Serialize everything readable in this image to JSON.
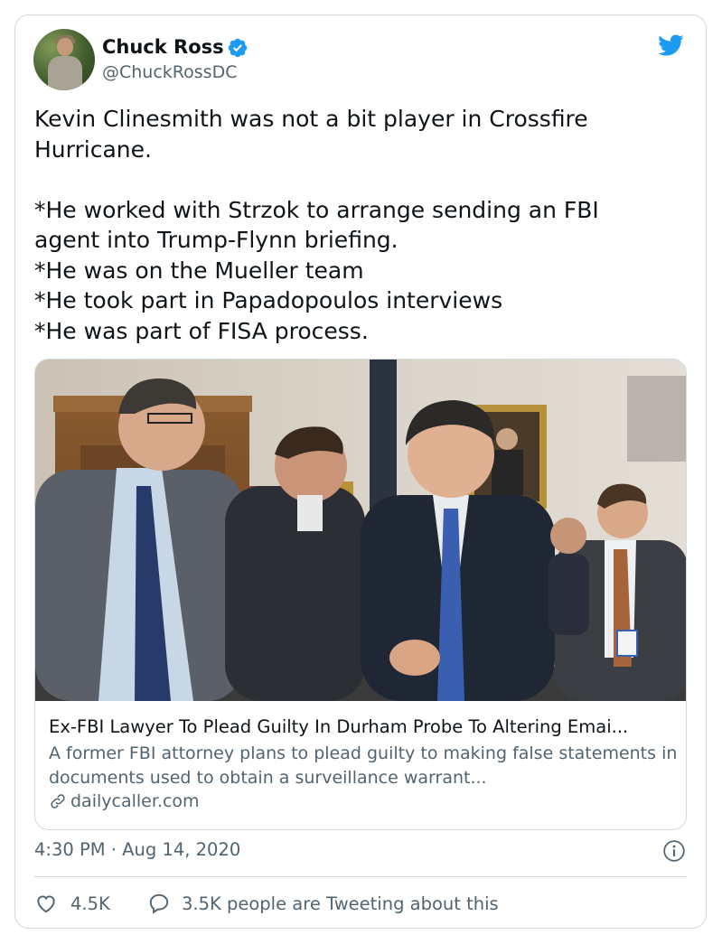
{
  "tweet": {
    "author_name": "Chuck Ross",
    "author_handle": "@ChuckRossDC",
    "verified_icon": "verified-badge-icon",
    "brand_icon": "twitter-bird-icon",
    "text": "Kevin Clinesmith was not a bit player in Crossfire\nHurricane.\n\n*He worked with Strzok to arrange sending an FBI\nagent into Trump-Flynn briefing.\n*He was on the Mueller team\n*He took part in Papadopoulos interviews\n*He was part of FISA process.",
    "timestamp": "4:30 PM · Aug 14, 2020"
  },
  "link_card": {
    "title": "Ex-FBI Lawyer To Plead Guilty In Durham Probe To Altering Emai...",
    "description": "A former FBI attorney plans to plead guilty to making false statements in documents used to obtain a surveillance warrant...",
    "domain": "dailycaller.com",
    "domain_icon": "link-icon"
  },
  "engagement": {
    "likes": "4.5K",
    "like_icon": "heart-icon",
    "conversation": "3.5K people are Tweeting about this",
    "conversation_icon": "speech-bubble-icon"
  },
  "colors": {
    "brand_blue": "#1d9bf0",
    "text_primary": "#0f1419",
    "text_secondary": "#536471",
    "border": "#cfd9de"
  }
}
